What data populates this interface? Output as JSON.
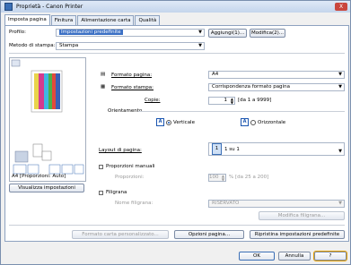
{
  "window": {
    "title": "Proprietà - Canon Printer",
    "close_label": "X"
  },
  "tabs": [
    "Imposta pagina",
    "Finitura",
    "Alimentazione carta",
    "Qualità"
  ],
  "profile": {
    "label": "Profilo:",
    "value": "Impostazioni predefinite",
    "add_button": "Aggiungi(1)...",
    "edit_button": "Modifica(2)..."
  },
  "output_method": {
    "label": "Metodo di stampa:",
    "value": "Stampa"
  },
  "preview": {
    "caption": "A4 [Proporzioni: Auto]",
    "view_settings_button": "Visualizza impostazioni"
  },
  "page_size": {
    "label": "Formato pagina:",
    "value": "A4"
  },
  "output_size": {
    "label": "Formato stampa:",
    "value": "Corrispondenza formato pagina"
  },
  "copies": {
    "label": "Copie:",
    "value": "1",
    "range": "[da 1 a 9999]"
  },
  "orientation": {
    "label": "Orientamento",
    "portrait": "Verticale",
    "landscape": "Orizzontale",
    "selected": "portrait"
  },
  "page_layout": {
    "label": "Layout di pagina:",
    "value": "1 su 1"
  },
  "manual_scaling": {
    "label": "Proporzioni manuali",
    "sub_label": "Proporzioni:",
    "value": "100",
    "range": "% [da 25 a 200]"
  },
  "watermark": {
    "label": "Filigrana",
    "name_label": "Nome filigrana:",
    "value": "RISERVATO",
    "edit_button": "Modifica filigrana..."
  },
  "bottom_buttons": {
    "custom_size": "Formato carta personalizzato...",
    "page_options": "Opzioni pagina...",
    "restore": "Ripristina impostazioni predefinite"
  },
  "dialog_buttons": {
    "ok": "OK",
    "cancel": "Annulla",
    "help": "?"
  }
}
